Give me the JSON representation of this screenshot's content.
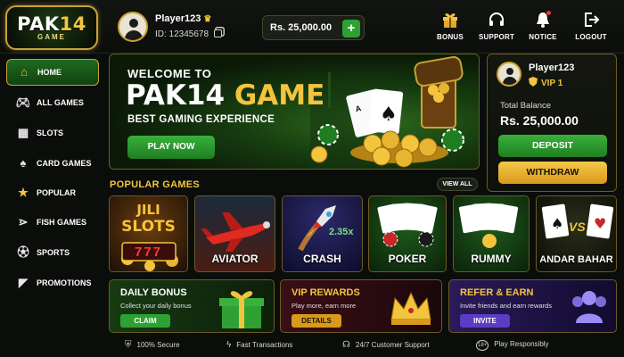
{
  "brand": {
    "logo_main_a": "PAK",
    "logo_main_b": "14",
    "logo_sub": "GAME"
  },
  "user": {
    "name": "Player123",
    "id": "ID: 12345678",
    "balance": "Rs. 25,000.00"
  },
  "header_actions": [
    {
      "label": "BONUS",
      "icon": "gift-icon"
    },
    {
      "label": "SUPPORT",
      "icon": "headset-icon"
    },
    {
      "label": "NOTICE",
      "icon": "bell-icon"
    },
    {
      "label": "LOGOUT",
      "icon": "logout-icon"
    }
  ],
  "nav": [
    {
      "label": "HOME",
      "icon": "home-icon",
      "active": true
    },
    {
      "label": "ALL GAMES",
      "icon": "gamepad-icon"
    },
    {
      "label": "SLOTS",
      "icon": "slot-machine-icon"
    },
    {
      "label": "CARD GAMES",
      "icon": "cards-icon"
    },
    {
      "label": "POPULAR",
      "icon": "star-icon"
    },
    {
      "label": "FISH GAMES",
      "icon": "fish-icon"
    },
    {
      "label": "SPORTS",
      "icon": "soccer-ball-icon"
    },
    {
      "label": "PROMOTIONS",
      "icon": "megaphone-icon"
    }
  ],
  "hero": {
    "welcome": "WELCOME TO",
    "title_a": "PAK14",
    "title_b": "GAME",
    "tagline": "BEST GAMING EXPERIENCE",
    "cta": "PLAY NOW"
  },
  "vip_panel": {
    "name": "Player123",
    "level": "VIP 1",
    "balance_label": "Total Balance",
    "balance": "Rs. 25,000.00",
    "deposit": "DEPOSIT",
    "withdraw": "WITHDRAW"
  },
  "popular": {
    "title": "POPULAR GAMES",
    "view_all": "VIEW ALL",
    "games": [
      {
        "label": "",
        "art_text": "JILI",
        "art_text2": "SLOTS",
        "art_text3": "777"
      },
      {
        "label": "AVIATOR"
      },
      {
        "label": "CRASH",
        "multiplier": "2.35x"
      },
      {
        "label": "POKER"
      },
      {
        "label": "RUMMY"
      },
      {
        "label": "ANDAR BAHAR",
        "vs": "VS"
      }
    ]
  },
  "promos": [
    {
      "title": "DAILY BONUS",
      "subtitle": "Collect your daily bonus",
      "button": "CLAIM"
    },
    {
      "title": "VIP REWARDS",
      "subtitle": "Play more, earn more",
      "button": "DETAILS"
    },
    {
      "title": "REFER & EARN",
      "subtitle": "Invite friends and earn rewards",
      "button": "INVITE"
    }
  ],
  "footer": [
    {
      "label": "100% Secure",
      "icon": "shield-icon"
    },
    {
      "label": "Fast Transactions",
      "icon": "lightning-icon"
    },
    {
      "label": "24/7 Customer Support",
      "icon": "headset-icon"
    },
    {
      "label": "Play Responsibly",
      "icon": "age-18-icon",
      "badge": "18+"
    }
  ],
  "colors": {
    "gold": "#f3c43d",
    "green": "#2fa134",
    "bg": "#0b0d0a",
    "border": "#6b5a26"
  }
}
